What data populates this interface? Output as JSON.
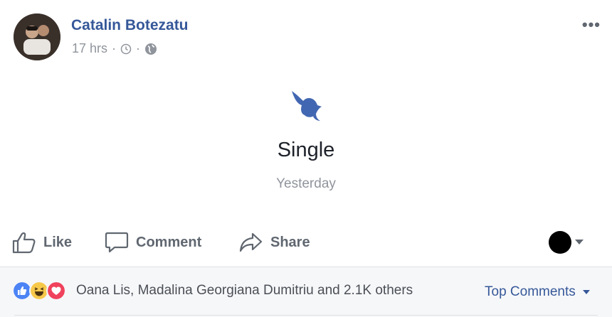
{
  "post": {
    "author": "Catalin Botezatu",
    "time": "17 hrs",
    "separator": "·",
    "options_label": "•••",
    "icons": {
      "clock": "clock-icon",
      "audience": "globe-icon",
      "options": "more-options-icon"
    }
  },
  "event": {
    "icon": "dove-icon",
    "title": "Single",
    "date": "Yesterday",
    "icon_color": "#4267b2"
  },
  "actions": {
    "like": "Like",
    "comment": "Comment",
    "share": "Share"
  },
  "reactions": {
    "icons": [
      "like-reaction-icon",
      "haha-reaction-icon",
      "love-reaction-icon"
    ],
    "summary": "Oana Lis, Madalina Georgiana Dumitriu and 2.1K others",
    "sort_label": "Top Comments"
  },
  "colors": {
    "link": "#365899",
    "muted": "#90949c",
    "action": "#606770",
    "footer_bg": "#f6f7f9"
  }
}
